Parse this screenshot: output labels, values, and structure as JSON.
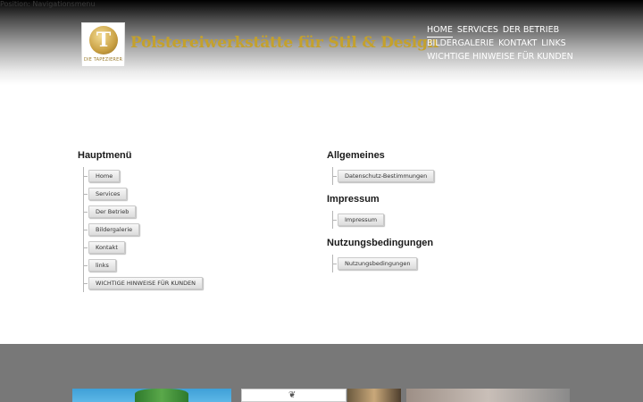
{
  "skip_link": "Position: Navigationsmenu",
  "logo": {
    "letter": "T",
    "caption": "DIE TAPEZIERER"
  },
  "site_title": "Polstereiwerkstätte für Stil & Design",
  "nav": {
    "row1": [
      "HOME",
      "SERVICES",
      "DER BETRIEB"
    ],
    "row2": [
      "BILDERGALERIE",
      "KONTAKT",
      "LINKS"
    ],
    "row3": [
      "WICHTIGE HINWEISE FÜR KUNDEN"
    ]
  },
  "hauptmenu": {
    "title": "Hauptmenü",
    "items": [
      "Home",
      "Services",
      "Der Betrieb",
      "Bildergalerie",
      "Kontakt",
      "links",
      "WICHTIGE HINWEISE FÜR KUNDEN"
    ]
  },
  "allgemeines": {
    "title": "Allgemeines",
    "items": [
      "Datenschutz-Bestimmungen"
    ]
  },
  "impressum": {
    "title": "Impressum",
    "items": [
      "Impressum"
    ]
  },
  "nutzung": {
    "title": "Nutzungsbedingungen",
    "items": [
      "Nutzungsbedingungen"
    ]
  },
  "colors": {
    "gold": "#c4a12c",
    "footer": "#787878"
  }
}
